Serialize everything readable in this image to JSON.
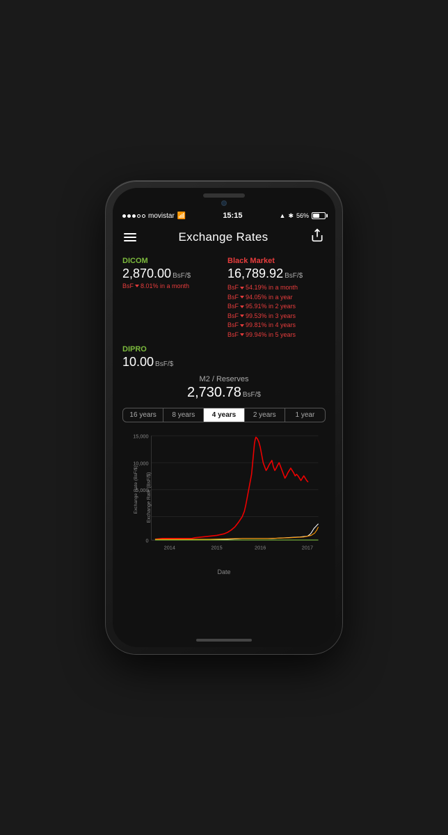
{
  "phone": {
    "status_bar": {
      "carrier": "movistar",
      "signal_dots": [
        true,
        true,
        true,
        false,
        false
      ],
      "wifi": "wifi",
      "time": "15:15",
      "location": true,
      "bluetooth": true,
      "battery_pct": "56%"
    },
    "header": {
      "title": "Exchange Rates",
      "menu_label": "menu",
      "share_label": "share"
    },
    "dicom": {
      "label": "DICOM",
      "value": "2,870.00",
      "unit": "BsF/$",
      "change_prefix": "BsF",
      "change": "8.01% in a month"
    },
    "black_market": {
      "label": "Black Market",
      "value": "16,789.92",
      "unit": "BsF/$",
      "changes": [
        "BsF  54.19% in a month",
        "BsF  94.05% in a year",
        "BsF  95.91% in 2 years",
        "BsF  99.53% in 3 years",
        "BsF  99.81% in 4 years",
        "BsF  99.94% in 5 years"
      ]
    },
    "dipro": {
      "label": "DIPRO",
      "value": "10.00",
      "unit": "BsF/$"
    },
    "m2": {
      "label": "M2 / Reserves",
      "value": "2,730.78",
      "unit": "BsF/$"
    },
    "chart_tabs": [
      {
        "label": "16 years",
        "active": false
      },
      {
        "label": "8 years",
        "active": false
      },
      {
        "label": "4 years",
        "active": true
      },
      {
        "label": "2 years",
        "active": false
      },
      {
        "label": "1 year",
        "active": false
      }
    ],
    "chart": {
      "y_label": "Exchange Rate (BsF/$)",
      "x_label": "Date",
      "y_ticks": [
        "15,000",
        "10,000",
        "5,000",
        "0"
      ],
      "x_ticks": [
        "2014",
        "2015",
        "2016",
        "2017"
      ]
    }
  }
}
